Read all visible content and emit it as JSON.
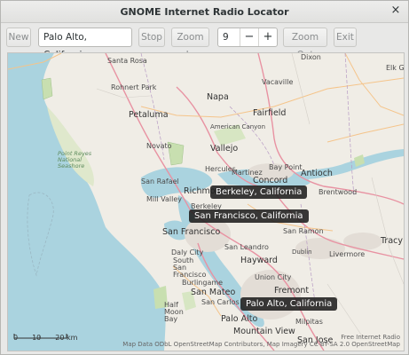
{
  "window": {
    "title": "GNOME Internet Radio Locator",
    "close_glyph": "×"
  },
  "toolbar": {
    "new_label": "New",
    "location_value": "Palo Alto, California",
    "stop_label": "Stop",
    "zoom_in_label": "Zoom In",
    "zoom_value": "9",
    "minus_glyph": "−",
    "plus_glyph": "+",
    "zoom_out_label": "Zoom Out",
    "exit_label": "Exit"
  },
  "map": {
    "places": [
      "Santa Rosa",
      "Rohnert Park",
      "Petaluma",
      "Napa",
      "Vacaville",
      "Fairfield",
      "Dixon",
      "Novato",
      "American Canyon",
      "Vallejo",
      "Point Reyes National Seashore",
      "San Rafael",
      "Mill Valley",
      "Richmond",
      "Hercules",
      "Martinez",
      "Bay Point",
      "Antioch",
      "Concord",
      "Brentwood",
      "Berkeley",
      "San Francisco",
      "Daly City",
      "South San Francisco",
      "San Ramon",
      "San Leandro",
      "Hayward",
      "Livermore",
      "Tracy",
      "Dublin",
      "Union City",
      "Fremont",
      "Burlingame",
      "San Mateo",
      "San Carlos",
      "Half Moon Bay",
      "Palo Alto",
      "Milpitas",
      "Mountain View",
      "San Jose",
      "Elk Gr"
    ],
    "markers": [
      "Berkeley, California",
      "San Francisco, California",
      "Palo Alto, California"
    ],
    "scale": {
      "zero": "0",
      "ten": "10",
      "twenty": "20 km"
    },
    "attribution_line1": "Free Internet Radio",
    "attribution_line2": "Map Data ODbL OpenStreetMap Contributors, Map Imagery CC-BY-SA 2.0 OpenStreetMap"
  }
}
